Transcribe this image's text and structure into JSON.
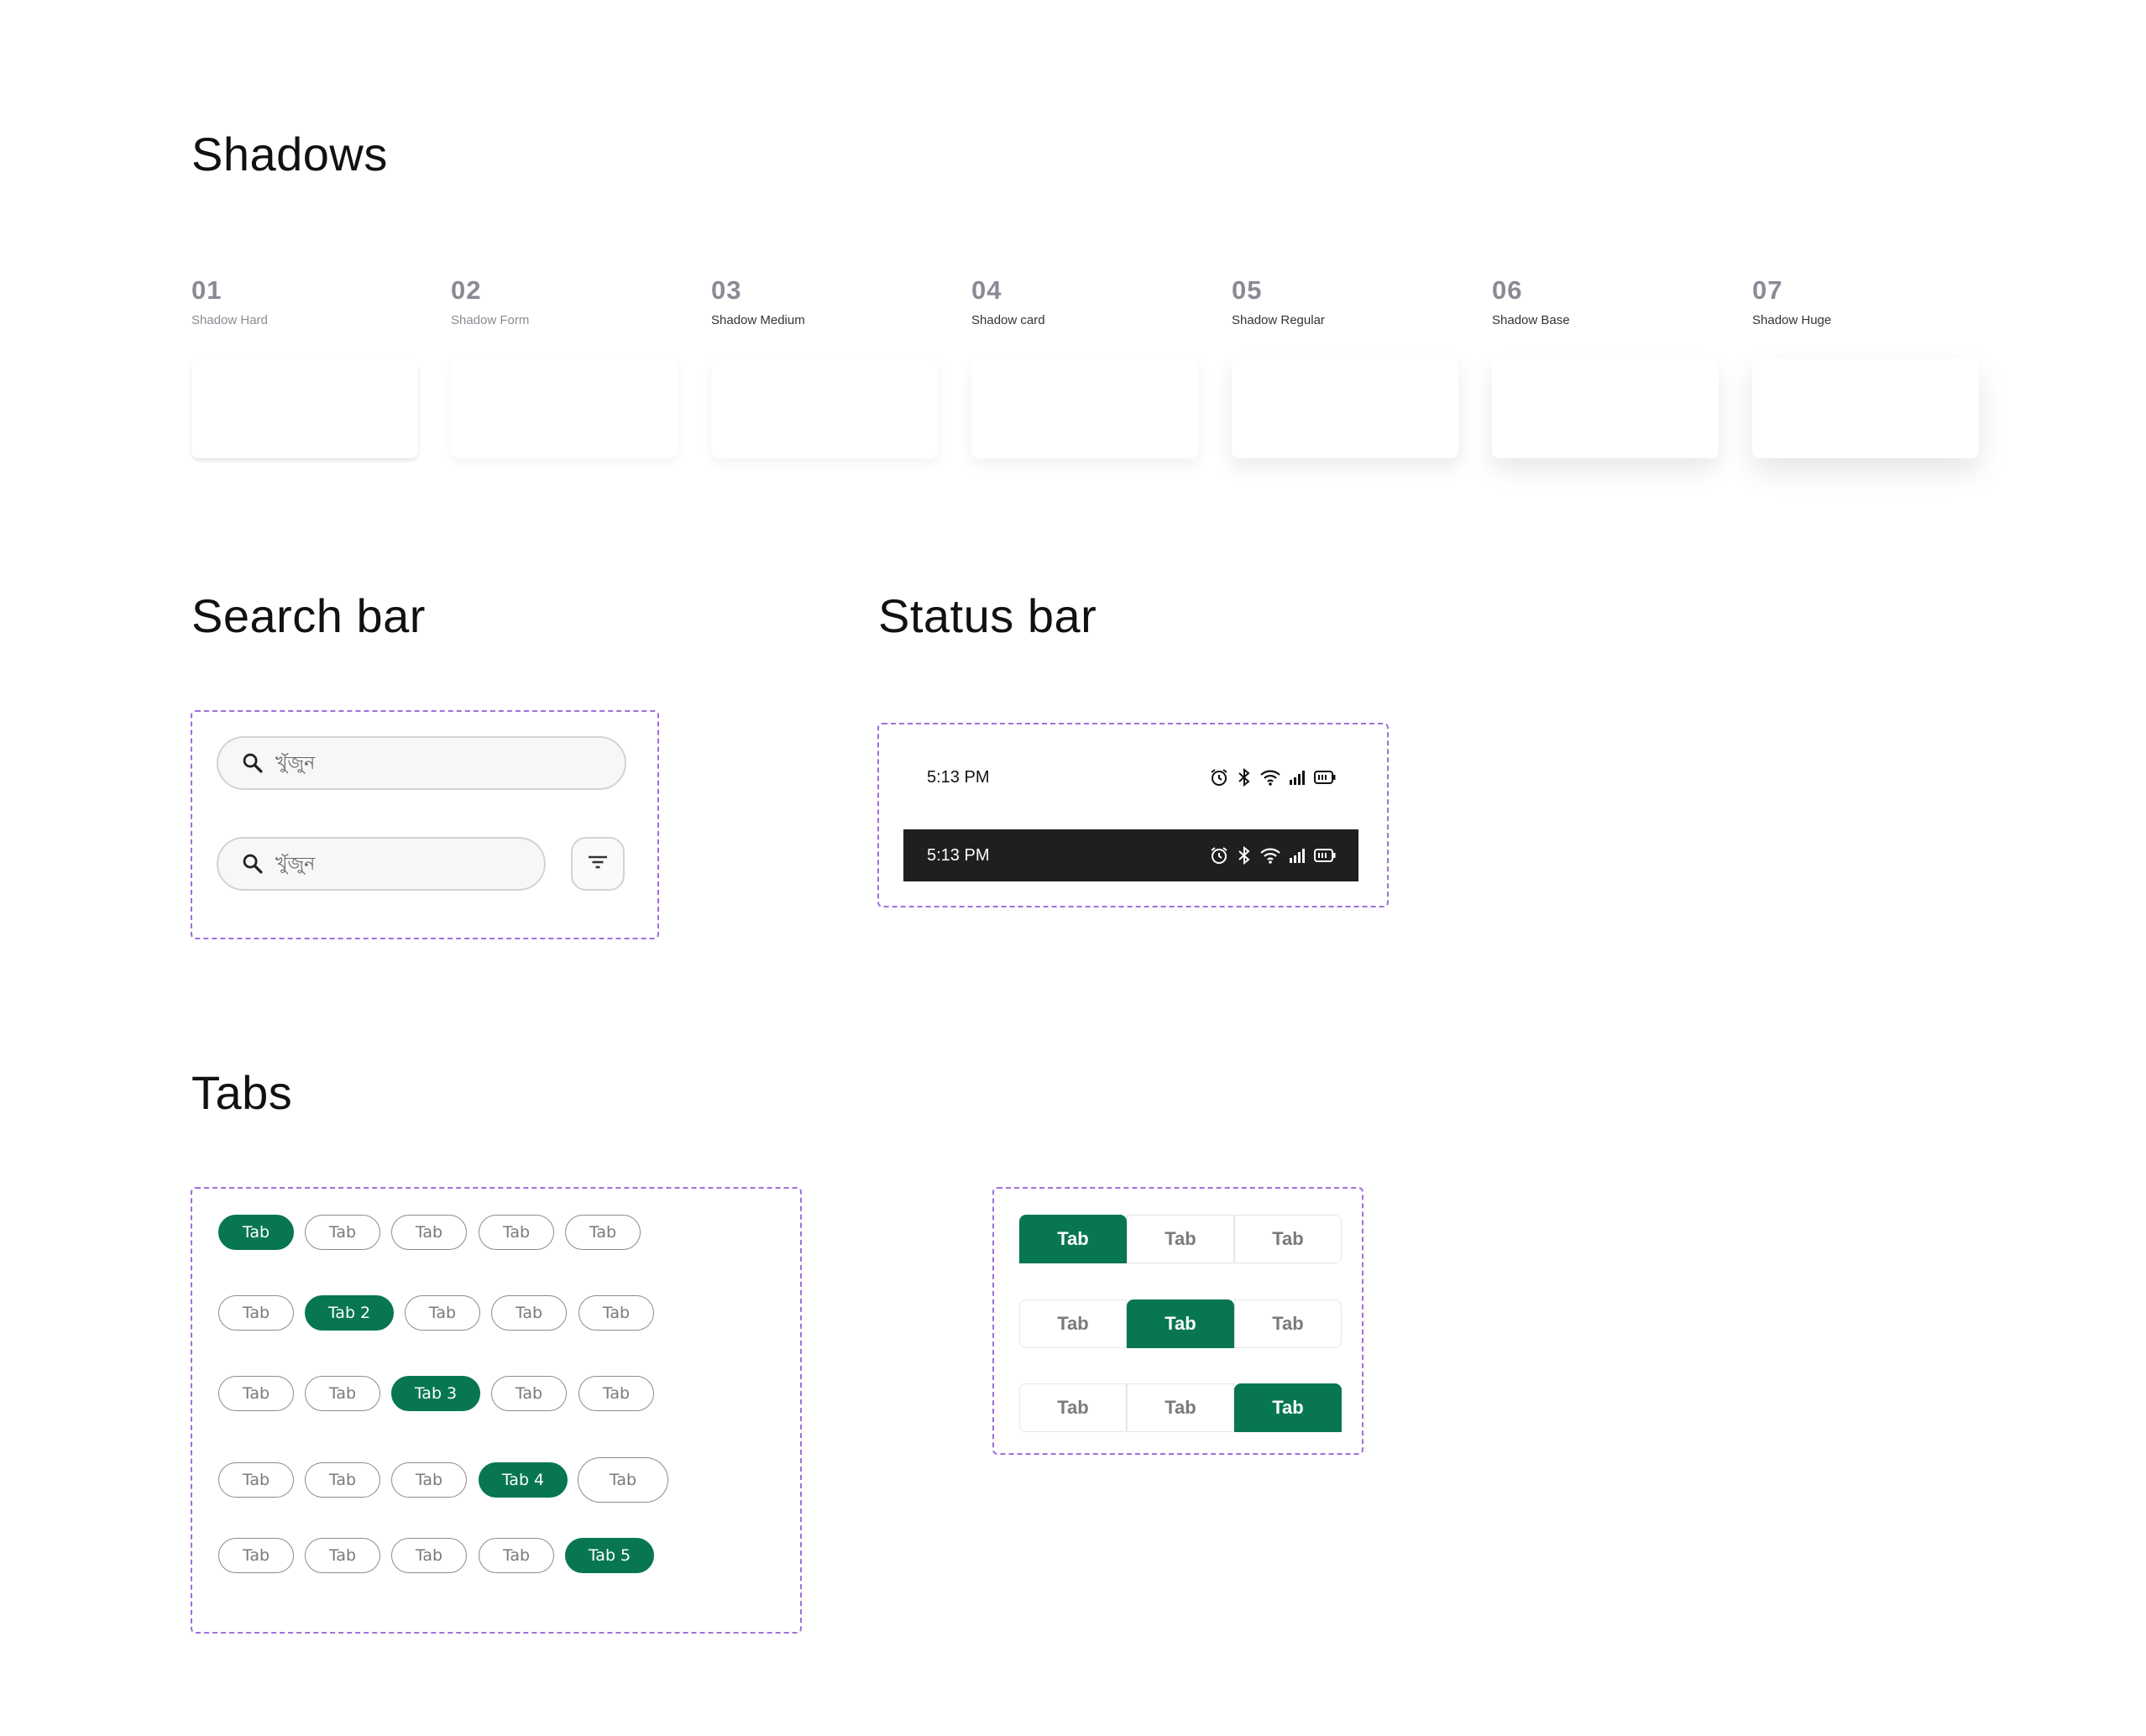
{
  "sections": {
    "shadows_title": "Shadows",
    "search_title": "Search bar",
    "status_title": "Status bar",
    "tabs_title": "Tabs"
  },
  "shadows": [
    {
      "num": "01",
      "name": "Shadow Hard"
    },
    {
      "num": "02",
      "name": "Shadow Form"
    },
    {
      "num": "03",
      "name": "Shadow Medium"
    },
    {
      "num": "04",
      "name": "Shadow card"
    },
    {
      "num": "05",
      "name": "Shadow Regular"
    },
    {
      "num": "06",
      "name": "Shadow Base"
    },
    {
      "num": "07",
      "name": "Shadow Huge"
    }
  ],
  "search": {
    "placeholder": "খুঁজুন",
    "icon": "search-icon",
    "filter_icon": "filter-icon"
  },
  "status_bar": {
    "time": "5:13 PM",
    "icons": [
      "alarm-icon",
      "bluetooth-icon",
      "wifi-icon",
      "signal-icon",
      "battery-icon"
    ]
  },
  "pill_tabs": [
    [
      "Tab",
      "Tab",
      "Tab",
      "Tab",
      "Tab"
    ],
    [
      "Tab",
      "Tab 2",
      "Tab",
      "Tab",
      "Tab"
    ],
    [
      "Tab",
      "Tab",
      "Tab 3",
      "Tab",
      "Tab"
    ],
    [
      "Tab",
      "Tab",
      "Tab",
      "Tab 4",
      "Tab"
    ],
    [
      "Tab",
      "Tab",
      "Tab",
      "Tab",
      "Tab 5"
    ]
  ],
  "segmented_tabs": [
    [
      "Tab",
      "Tab",
      "Tab"
    ],
    [
      "Tab",
      "Tab",
      "Tab"
    ],
    [
      "Tab",
      "Tab",
      "Tab"
    ]
  ],
  "colors": {
    "accent": "#087751",
    "dashed_border": "#a070d8",
    "dark_status": "#1f1f21"
  }
}
